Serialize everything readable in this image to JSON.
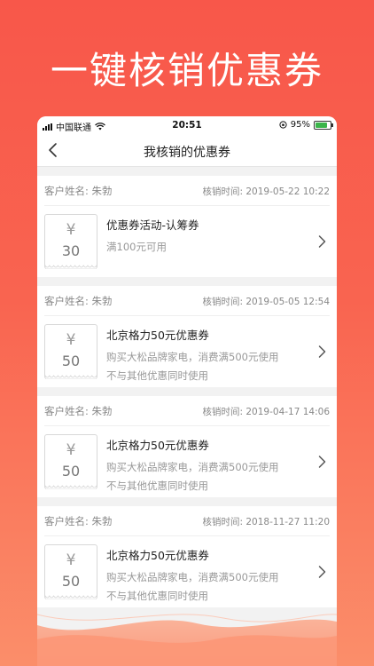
{
  "promo": {
    "title": "一键核销优惠券"
  },
  "status_bar": {
    "carrier": "中国联通",
    "time": "20:51",
    "battery": "95%"
  },
  "nav": {
    "title": "我核销的优惠券"
  },
  "coupons": [
    {
      "customer": "客户姓名: 朱勃",
      "time": "核销时间: 2019-05-22 10:22",
      "currency": "¥",
      "amount": "30",
      "name": "优惠券活动-认筹券",
      "line1": "满100元可用",
      "line2": ""
    },
    {
      "customer": "客户姓名: 朱勃",
      "time": "核销时间: 2019-05-05 12:54",
      "currency": "¥",
      "amount": "50",
      "name": "北京格力50元优惠券",
      "line1": "购买大松品牌家电，消费满500元使用",
      "line2": "不与其他优惠同时使用"
    },
    {
      "customer": "客户姓名: 朱勃",
      "time": "核销时间: 2019-04-17 14:06",
      "currency": "¥",
      "amount": "50",
      "name": "北京格力50元优惠券",
      "line1": "购买大松品牌家电，消费满500元使用",
      "line2": "不与其他优惠同时使用"
    },
    {
      "customer": "客户姓名: 朱勃",
      "time": "核销时间: 2018-11-27 11:20",
      "currency": "¥",
      "amount": "50",
      "name": "北京格力50元优惠券",
      "line1": "购买大松品牌家电，消费满500元使用",
      "line2": "不与其他优惠同时使用"
    }
  ],
  "icons": {
    "back": "chevron-left-icon",
    "row_arrow": "chevron-right-icon",
    "wifi": "wifi-icon",
    "battery": "battery-icon",
    "signal": "signal-icon"
  },
  "colors": {
    "accent": "#F8574A",
    "accent_light": "#FB8E6A",
    "battery_green": "#3BB54A"
  }
}
